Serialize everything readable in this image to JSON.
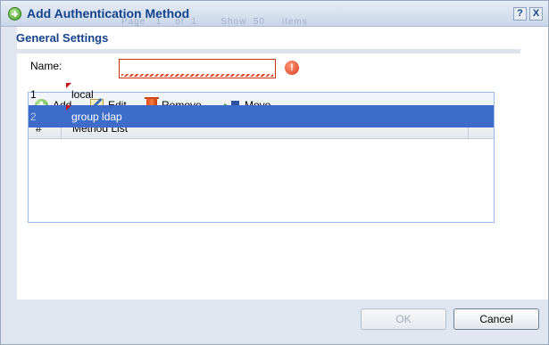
{
  "dialog": {
    "title": "Add Authentication Method",
    "ghost_paging": "Page   1    of  1       Show  50     items",
    "help_label": "?",
    "close_label": "X"
  },
  "general": {
    "section_title": "General Settings",
    "name_label": "Name:",
    "name_value": "",
    "error_icon": "!"
  },
  "toolbar": {
    "add_label": "Add",
    "edit_label": "Edit",
    "remove_label": "Remove",
    "move_label": "Move"
  },
  "table": {
    "columns": [
      "#",
      "Method List"
    ],
    "rows": [
      {
        "num": "1",
        "method": "local",
        "selected": false
      },
      {
        "num": "2",
        "method": "group ldap",
        "selected": true
      }
    ]
  },
  "buttons": {
    "ok_label": "OK",
    "cancel_label": "Cancel"
  },
  "colors": {
    "title_text": "#15428b",
    "selected_row": "#3e6ccb",
    "error": "#d8391a"
  }
}
